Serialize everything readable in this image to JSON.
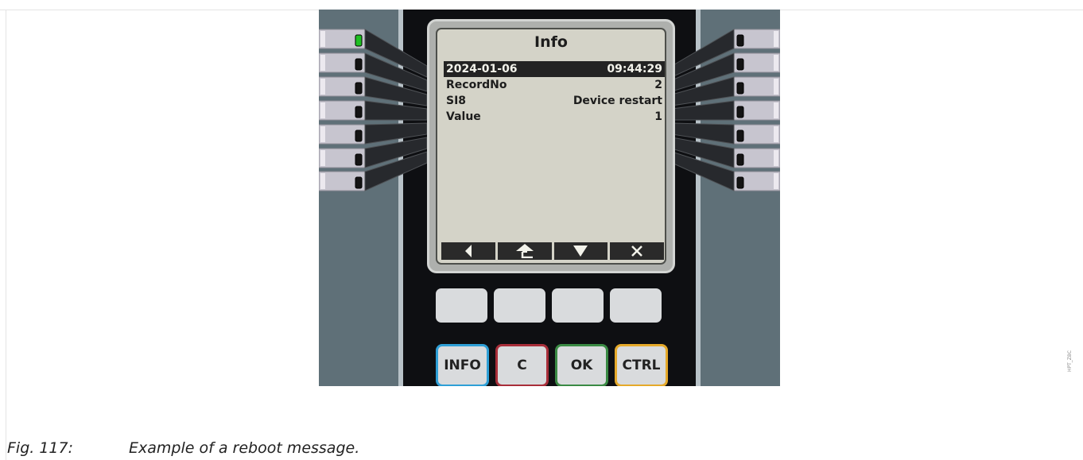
{
  "display": {
    "title": "Info",
    "rows": [
      {
        "label": "2024-01-06",
        "value": "09:44:29",
        "selected": true
      },
      {
        "label": "RecordNo",
        "value": "2"
      },
      {
        "label": "SI8",
        "value": "Device restart"
      },
      {
        "label": "Value",
        "value": "1"
      }
    ],
    "softkeys": [
      "left-arrow-icon",
      "up-to-parent-icon",
      "down-arrow-icon",
      "close-icon"
    ]
  },
  "leds": {
    "left": [
      "green",
      "off",
      "off",
      "off",
      "off",
      "off",
      "off"
    ],
    "right": [
      "off",
      "off",
      "off",
      "off",
      "off",
      "off",
      "off"
    ]
  },
  "keys": {
    "info": "INFO",
    "c": "C",
    "ok": "OK",
    "ctrl": "CTRL"
  },
  "colors": {
    "info": "#2e9fd6",
    "c": "#a82e39",
    "ok": "#3a8a44",
    "ctrl": "#e5a92a",
    "led_on": "#1fbf22"
  },
  "figure": {
    "number": "Fig. 117:",
    "caption": "Example of a reboot message."
  },
  "side_code": "HPT_Z8C"
}
